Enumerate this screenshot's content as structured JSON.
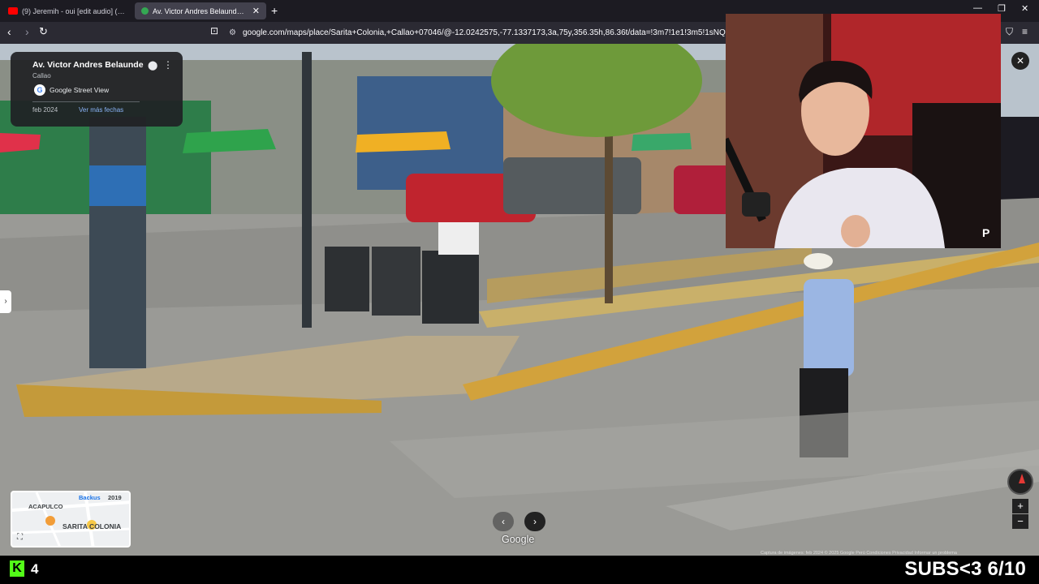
{
  "browser": {
    "tabs": [
      {
        "title": "(9) Jeremih - oui [edit audio] (rizz son",
        "favicon_color": "#ff0000",
        "active": false
      },
      {
        "title": "Av. Victor Andres Belaunde - Go",
        "favicon_color": "#34a853",
        "active": true
      }
    ],
    "new_tab_icon": "plus-icon",
    "url": "google.com/maps/place/Sarita+Colonia,+Callao+07046/@-12.0242575,-77.1337173,3a,75y,356.35h,86.36t/data=!3m7!1e1!3m5!1sNQyx2u-0a0"
  },
  "streetview": {
    "place_title": "Av. Victor Andres Belaunde",
    "place_subtitle": "Callao",
    "source_label": "Google Street View",
    "capture_date": "feb 2024",
    "more_dates_label": "Ver más fechas",
    "watermark": "Google",
    "attribution": "Captura de imágenes: feb 2024    © 2025 Google    Perú    Condiciones    Privacidad    Informar un problema",
    "minimap": {
      "labels": [
        "Backus",
        "2019",
        "ACAPULCO",
        "SARITA COLONIA"
      ]
    }
  },
  "stream": {
    "viewer_count": "4",
    "overlay_text": "SUBS<3 6/10",
    "platform_accent": "#53fc18",
    "webcam_logo": "P"
  }
}
